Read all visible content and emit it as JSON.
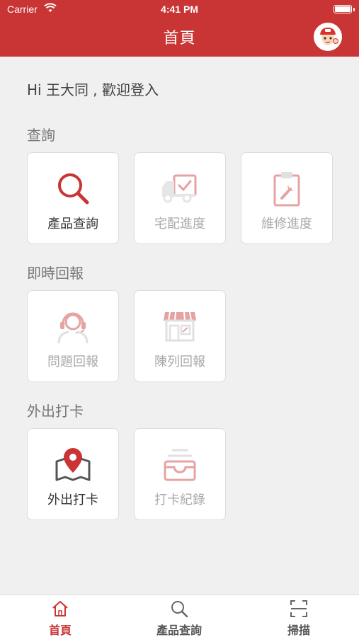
{
  "status_bar": {
    "carrier": "Carrier",
    "time": "4:41 PM"
  },
  "header": {
    "title": "首頁"
  },
  "greeting": "Hi 王大同 , 歡迎登入",
  "colors": {
    "primary": "#c93434",
    "icon_faded": "#e5a3a3",
    "background": "#f0f0f0"
  },
  "sections": [
    {
      "title": "查詢",
      "items": [
        {
          "label": "產品查詢",
          "icon": "magnifier-icon",
          "active": true
        },
        {
          "label": "宅配進度",
          "icon": "delivery-truck-icon",
          "active": false
        },
        {
          "label": "維修進度",
          "icon": "clipboard-wrench-icon",
          "active": false
        }
      ]
    },
    {
      "title": "即時回報",
      "items": [
        {
          "label": "問題回報",
          "icon": "headset-agent-icon",
          "active": false
        },
        {
          "label": "陳列回報",
          "icon": "storefront-icon",
          "active": false
        }
      ]
    },
    {
      "title": "外出打卡",
      "items": [
        {
          "label": "外出打卡",
          "icon": "map-pin-icon",
          "active": true
        },
        {
          "label": "打卡紀錄",
          "icon": "archive-box-icon",
          "active": false
        }
      ]
    }
  ],
  "tabbar": [
    {
      "label": "首頁",
      "icon": "home-icon",
      "active": true
    },
    {
      "label": "產品查詢",
      "icon": "search-icon",
      "active": false
    },
    {
      "label": "掃描",
      "icon": "scan-icon",
      "active": false
    }
  ]
}
